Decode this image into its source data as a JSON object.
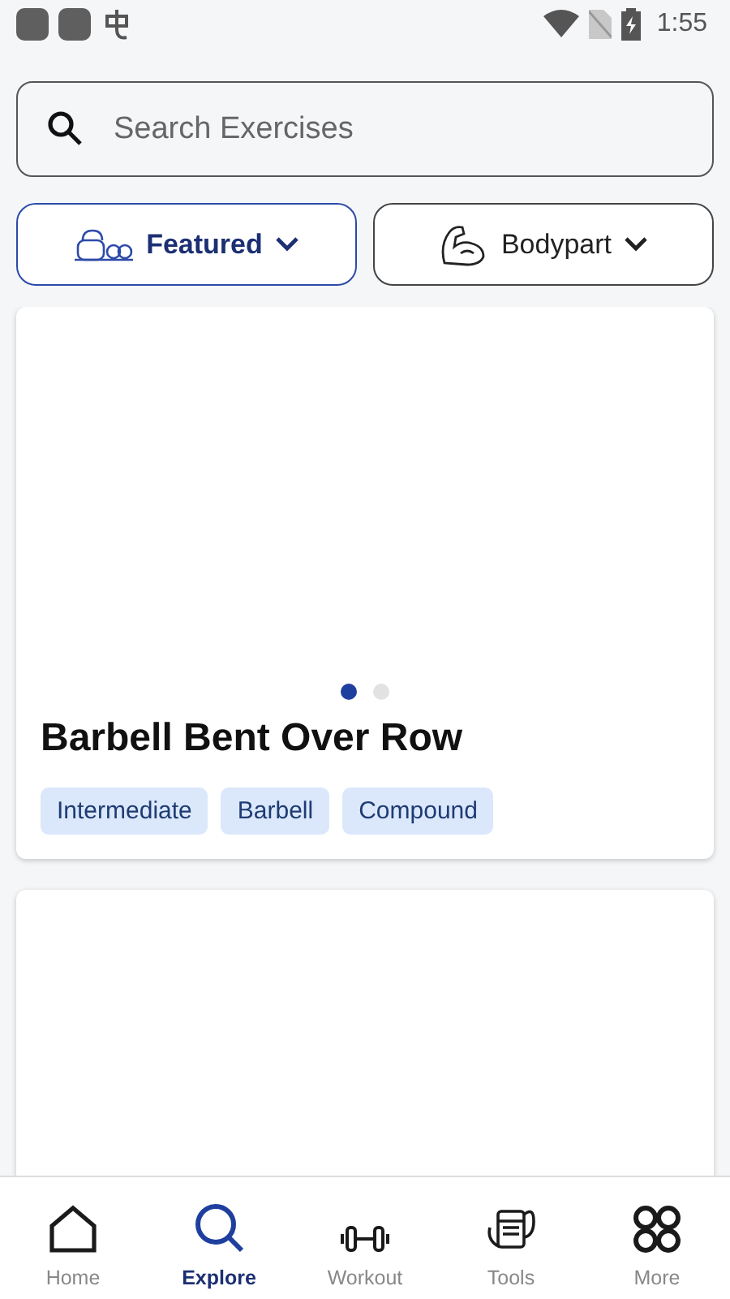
{
  "status_bar": {
    "time": "1:55"
  },
  "search": {
    "placeholder": "Search Exercises"
  },
  "filters": [
    {
      "label": "Featured",
      "kind": "featured",
      "selected": true
    },
    {
      "label": "Bodypart",
      "kind": "bodypart",
      "selected": false
    }
  ],
  "cards": [
    {
      "kind": "exercise",
      "title": "Barbell Bent Over Row",
      "pages": [
        {
          "selected": true
        },
        {
          "selected": false
        }
      ],
      "tags": [
        "Intermediate",
        "Barbell",
        "Compound"
      ]
    },
    {
      "kind": "blank"
    }
  ],
  "nav": [
    {
      "label": "Home",
      "kind": "home",
      "selected": false
    },
    {
      "label": "Explore",
      "kind": "explore",
      "selected": true
    },
    {
      "label": "Workout",
      "kind": "workout",
      "selected": false
    },
    {
      "label": "Tools",
      "kind": "tools",
      "selected": false
    },
    {
      "label": "More",
      "kind": "more",
      "selected": false
    }
  ]
}
